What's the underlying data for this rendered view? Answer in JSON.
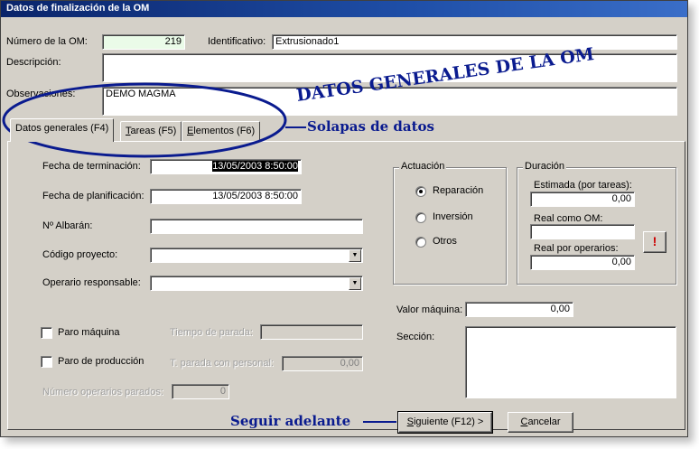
{
  "window": {
    "title": "Datos de finalización de la OM"
  },
  "header": {
    "numero_om_label": "Número de la OM:",
    "numero_om_value": "219",
    "identificativo_label": "Identificativo:",
    "identificativo_value": "Extrusionado1",
    "descripcion_label": "Descripción:",
    "descripcion_value": "",
    "observaciones_label": "Observaciones:",
    "observaciones_value": "DEMO MAGMA"
  },
  "tabs": [
    {
      "label_pre": "Datos generales (F4)",
      "label_u": "",
      "label_post": ""
    },
    {
      "label_pre": "",
      "label_u": "T",
      "label_post": "areas (F5)"
    },
    {
      "label_pre": "",
      "label_u": "E",
      "label_post": "lementos (F6)"
    }
  ],
  "general": {
    "fecha_terminacion_label": "Fecha de terminación:",
    "fecha_terminacion_value": "13/05/2003 8:50:00",
    "fecha_planificacion_label": "Fecha de planificación:",
    "fecha_planificacion_value": "13/05/2003 8:50:00",
    "albaran_label": "Nº Albarán:",
    "albaran_value": "",
    "codigo_proyecto_label": "Código proyecto:",
    "codigo_proyecto_value": "",
    "operario_label": "Operario responsable:",
    "operario_value": "",
    "paro_maquina_label": "Paro máquina",
    "tiempo_parada_label": "Tiempo de parada:",
    "tiempo_parada_value": "",
    "paro_produccion_label": "Paro de producción",
    "t_parada_personal_label": "T. parada con personal:",
    "t_parada_personal_value": "0,00",
    "num_operarios_label": "Número operarios parados:",
    "num_operarios_value": "0"
  },
  "actuacion": {
    "title": "Actuación",
    "options": [
      "Reparación",
      "Inversión",
      "Otros"
    ],
    "selected": "Reparación"
  },
  "duracion": {
    "title": "Duración",
    "estimada_label": "Estimada (por tareas):",
    "estimada_value": "0,00",
    "real_om_label": "Real como OM:",
    "real_om_value": "",
    "real_operarios_label": "Real por operarios:",
    "real_operarios_value": "0,00",
    "alert_button": "!"
  },
  "valor_maquina": {
    "label": "Valor máquina:",
    "value": "0,00"
  },
  "seccion": {
    "label": "Sección:",
    "value": ""
  },
  "buttons": {
    "siguiente_u": "S",
    "siguiente_rest": "iguiente (F12) >",
    "cancelar_u": "C",
    "cancelar_rest": "ancelar"
  },
  "annotations": {
    "datos_generales": "DATOS GENERALES DE LA OM",
    "solapas": "Solapas de datos",
    "seguir": "Seguir adelante"
  },
  "colors": {
    "title_bar": "#0a246a",
    "annotation": "#0a1b8f",
    "alert": "#cc0000",
    "dialog_face": "#d4d0c8"
  }
}
